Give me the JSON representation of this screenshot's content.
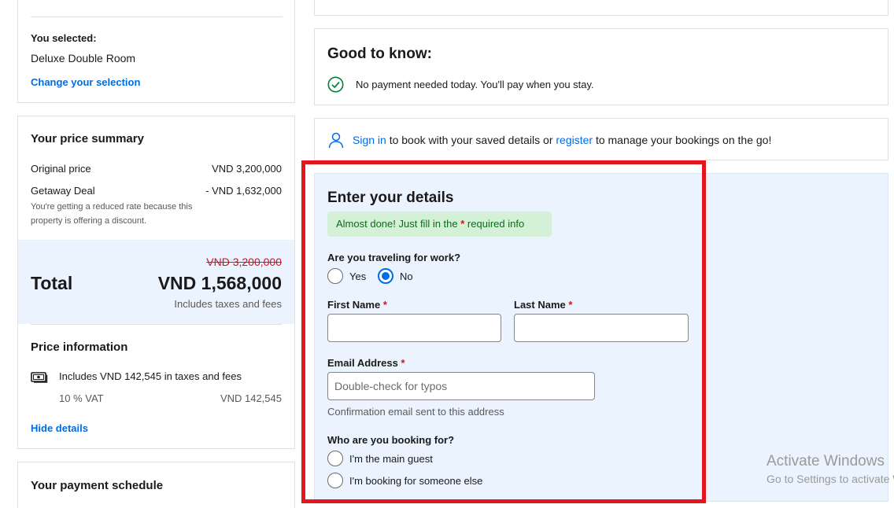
{
  "sidebar": {
    "selection": {
      "heading": "You selected:",
      "room": "Deluxe Double Room",
      "change_link": "Change your selection"
    },
    "price_summary": {
      "title": "Your price summary",
      "original_label": "Original price",
      "original_value": "VND 3,200,000",
      "deal_label": "Getaway Deal",
      "deal_value": "- VND 1,632,000",
      "deal_note": "You're getting a reduced rate because this property is offering a discount.",
      "total_strike": "VND 3,200,000",
      "total_label": "Total",
      "total_value": "VND 1,568,000",
      "total_note": "Includes taxes and fees"
    },
    "price_info": {
      "title": "Price information",
      "taxes_text": "Includes VND 142,545 in taxes and fees",
      "vat_label": "10 % VAT",
      "vat_value": "VND 142,545",
      "hide_link": "Hide details"
    },
    "payment_schedule": {
      "title": "Your payment schedule"
    }
  },
  "main": {
    "good_to_know": {
      "title": "Good to know:",
      "item": "No payment needed today. You'll pay when you stay."
    },
    "signin_banner": {
      "signin_link": "Sign in",
      "text_1": " to book with your saved details or ",
      "register_link": "register",
      "text_2": " to manage your bookings on the go!"
    },
    "details_form": {
      "title": "Enter your details",
      "notice_prefix": "Almost done! Just fill in the ",
      "notice_star": "*",
      "notice_suffix": " required info",
      "work_question": "Are you traveling for work?",
      "work_yes": "Yes",
      "work_no": "No",
      "work_selected": "No",
      "first_name_label": "First Name",
      "last_name_label": "Last Name",
      "required_star": "*",
      "first_name_value": "",
      "last_name_value": "",
      "email_label": "Email Address",
      "email_placeholder": "Double-check for typos",
      "email_value": "",
      "email_note": "Confirmation email sent to this address",
      "booking_for_question": "Who are you booking for?",
      "booking_main": "I'm the main guest",
      "booking_else": "I'm booking for someone else"
    }
  },
  "watermark": {
    "line1": "Activate Windows",
    "line2": "Go to Settings to activate Windows."
  },
  "colors": {
    "link": "#006ce4",
    "highlight_border": "#e3161e",
    "form_bg": "#ebf3ff",
    "notice_bg": "#d4f0d7",
    "notice_text": "#0c6b1c",
    "check_green": "#008234"
  }
}
